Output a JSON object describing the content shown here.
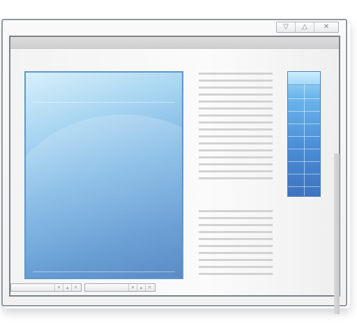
{
  "window": {
    "caption_buttons": [
      {
        "name": "minimize-icon",
        "glyph": "▽"
      },
      {
        "name": "maximize-icon",
        "glyph": "△"
      },
      {
        "name": "close-icon",
        "glyph": "✕"
      }
    ]
  },
  "colors": {
    "accent_blue": "#5a94cf",
    "frame": "#7a818a",
    "line_gray": "#d2d2d2"
  },
  "taskbar": {
    "items": [
      {
        "glyphs": [
          "▾",
          "▴",
          "✕"
        ]
      },
      {
        "glyphs": [
          "▾",
          "▴",
          "✕"
        ]
      }
    ]
  }
}
